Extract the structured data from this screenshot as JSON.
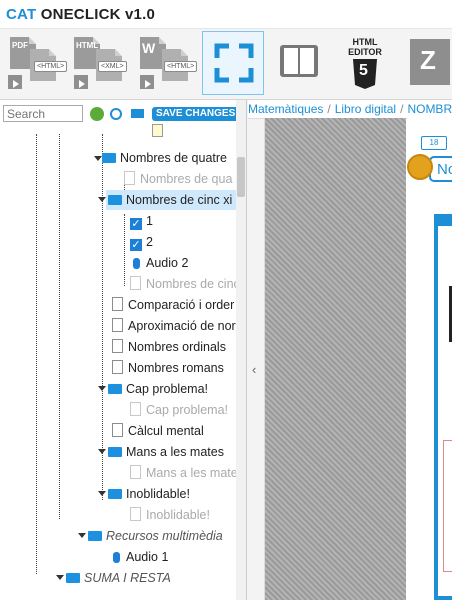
{
  "app": {
    "title_prefix": "CAT",
    "title_rest": " ONECLICK v1.0"
  },
  "toolbar": {
    "buttons": [
      {
        "name": "pdf-to-html-button",
        "label_top": "PDF",
        "label_tag": "<HTML>"
      },
      {
        "name": "html-to-xml-button",
        "label_top": "HTML",
        "label_tag": "<XML>"
      },
      {
        "name": "word-to-html-button",
        "label_top": "W",
        "label_tag": "<HTML>"
      },
      {
        "name": "fullscreen-button"
      },
      {
        "name": "book-button"
      },
      {
        "name": "html-editor-button",
        "label_top": "HTML",
        "label_sub": "EDITOR",
        "label_num": "5"
      },
      {
        "name": "zip-button",
        "label_top": "Z"
      }
    ]
  },
  "sidebar": {
    "search_placeholder": "Search",
    "save_label": "SAVE CHANGES"
  },
  "tree": [
    {
      "text": "Nombres de quatre",
      "icon": "folder",
      "faded": false
    },
    {
      "text": "Nombres de qua",
      "icon": "page",
      "faded": true
    },
    {
      "text": "Nombres de cinc xi",
      "icon": "folder",
      "faded": false,
      "selected": true
    },
    {
      "text": "1",
      "icon": "check",
      "faded": false
    },
    {
      "text": "2",
      "icon": "check",
      "faded": false
    },
    {
      "text": "Audio 2",
      "icon": "mic",
      "faded": false
    },
    {
      "text": "Nombres de cinc",
      "icon": "page",
      "faded": true
    },
    {
      "text": "Comparació i order",
      "icon": "page",
      "faded": false
    },
    {
      "text": "Aproximació de nor",
      "icon": "page",
      "faded": false
    },
    {
      "text": "Nombres ordinals",
      "icon": "page",
      "faded": false
    },
    {
      "text": "Nombres romans",
      "icon": "page",
      "faded": false
    },
    {
      "text": "Cap problema!",
      "icon": "folder",
      "faded": false
    },
    {
      "text": "Cap problema!",
      "icon": "page",
      "faded": true
    },
    {
      "text": "Càlcul mental",
      "icon": "page",
      "faded": false
    },
    {
      "text": "Mans a les mates",
      "icon": "folder",
      "faded": false
    },
    {
      "text": "Mans a les mate",
      "icon": "page",
      "faded": true
    },
    {
      "text": "Inoblidable!",
      "icon": "folder",
      "faded": false
    },
    {
      "text": "Inoblidable!",
      "icon": "page",
      "faded": true
    },
    {
      "text": "Recursos multimèdia",
      "icon": "folder",
      "faded": false,
      "italic": true
    },
    {
      "text": "Audio 1",
      "icon": "mic",
      "faded": false
    },
    {
      "text": "SUMA I RESTA",
      "icon": "folder",
      "faded": false,
      "italic": true
    }
  ],
  "breadcrumb": [
    "Matemàtiques",
    "Libro digital",
    "NOMBRES"
  ],
  "preview": {
    "badge": "18",
    "tab_text": "No"
  },
  "colors": {
    "accent": "#1d8fd6",
    "folder": "#1e90e0"
  }
}
